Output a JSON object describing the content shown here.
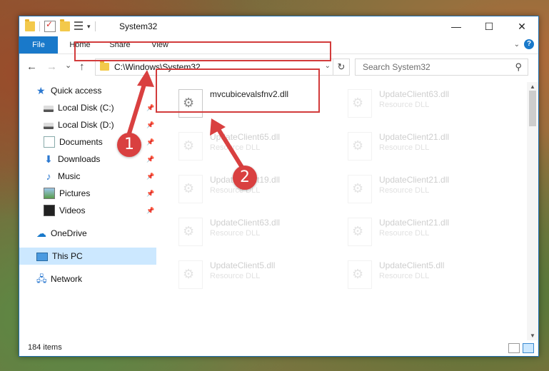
{
  "window": {
    "title": "System32",
    "controls": {
      "minimize": "—",
      "maximize": "☐",
      "close": "✕"
    }
  },
  "ribbon": {
    "tabs": [
      "File",
      "Home",
      "Share",
      "View"
    ],
    "help": "?"
  },
  "navigation": {
    "back": "←",
    "forward": "→",
    "recent": "⌄",
    "up": "↑",
    "address": "C:\\Windows\\System32",
    "search_placeholder": "Search System32"
  },
  "sidebar": {
    "items": [
      {
        "label": "Quick access",
        "icon": "star-icon"
      },
      {
        "label": "Local Disk (C:)",
        "icon": "disk-icon",
        "pinned": true
      },
      {
        "label": "Local Disk (D:)",
        "icon": "disk-icon",
        "pinned": true
      },
      {
        "label": "Documents",
        "icon": "documents-icon",
        "pinned": true
      },
      {
        "label": "Downloads",
        "icon": "downloads-icon",
        "pinned": true
      },
      {
        "label": "Music",
        "icon": "music-icon",
        "pinned": true
      },
      {
        "label": "Pictures",
        "icon": "pictures-icon",
        "pinned": true
      },
      {
        "label": "Videos",
        "icon": "videos-icon",
        "pinned": true
      },
      {
        "label": "OneDrive",
        "icon": "onedrive-icon"
      },
      {
        "label": "This PC",
        "icon": "pc-icon",
        "selected": true
      },
      {
        "label": "Network",
        "icon": "network-icon"
      }
    ]
  },
  "files": [
    {
      "name": "mvcubicevalsfnv2.dll",
      "type": "",
      "highlighted": true
    },
    {
      "name": "UpdateClient63.dll",
      "type": "Resource DLL"
    },
    {
      "name": "UpdateClient65.dll",
      "type": "Resource DLL"
    },
    {
      "name": "UpdateClient21.dll",
      "type": "Resource DLL"
    },
    {
      "name": "UpdateClient19.dll",
      "type": "Resource DLL"
    },
    {
      "name": "UpdateClient21.dll",
      "type": "Resource DLL"
    },
    {
      "name": "UpdateClient63.dll",
      "type": "Resource DLL"
    },
    {
      "name": "UpdateClient21.dll",
      "type": "Resource DLL"
    },
    {
      "name": "UpdateClient5.dll",
      "type": "Resource DLL"
    },
    {
      "name": "UpdateClient5.dll",
      "type": "Resource DLL"
    }
  ],
  "status": {
    "item_count": "184 items"
  },
  "callouts": [
    "1",
    "2"
  ],
  "colors": {
    "accent": "#1979ca",
    "highlight": "#d23b3b",
    "selected": "#cce8ff"
  }
}
